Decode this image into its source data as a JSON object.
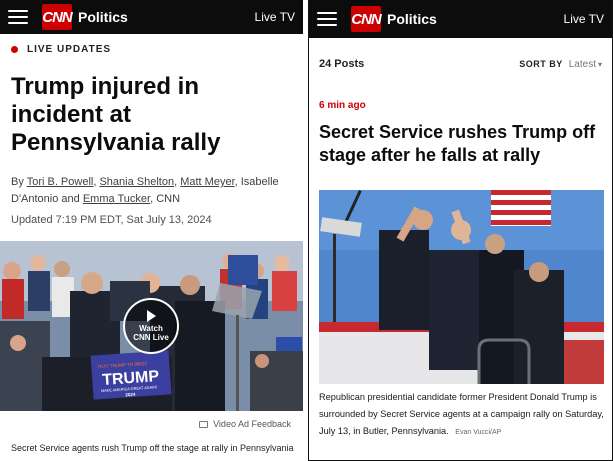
{
  "left": {
    "header": {
      "logo": "CNN",
      "section": "Politics",
      "live_tv": "Live TV"
    },
    "live_label": "LIVE UPDATES",
    "headline": "Trump injured in incident at Pennsylvania rally",
    "byline_prefix": "By",
    "authors": [
      "Tori B. Powell",
      "Shania Shelton",
      "Matt Meyer",
      "Isabelle D'Antonio",
      "Emma Tucker"
    ],
    "byline_suffix": "CNN",
    "updated": "Updated 7:19 PM EDT, Sat July 13, 2024",
    "video": {
      "watch_line1": "Watch",
      "watch_line2": "CNN Live",
      "sign_small": "TEXT TRUMP TO 88022",
      "sign_big": "TRUMP",
      "sign_sub": "MAKE AMERICA GREAT AGAIN!",
      "sign_year": "2024"
    },
    "video_feedback": "Video Ad Feedback",
    "caption": "Secret Service agents rush Trump off the stage at rally in Pennsylvania"
  },
  "right": {
    "header": {
      "logo": "CNN",
      "section": "Politics",
      "live_tv": "Live TV"
    },
    "posts_count": "24 Posts",
    "sort_by": "SORT BY",
    "sort_value": "Latest",
    "post_time": "6 min ago",
    "headline": "Secret Service rushes Trump off stage after he falls at rally",
    "caption": "Republican presidential candidate former President Donald Trump is surrounded by Secret Service agents at a campaign rally on Saturday, July 13, in Butler, Pennsylvania.",
    "credit": "Evan Vucci/AP"
  },
  "colors": {
    "brand_red": "#cc0000",
    "header_bg": "#0c0c0c",
    "sky_blue": "#4f86cc"
  },
  "icons": [
    "hamburger-icon",
    "play-icon",
    "feedback-icon",
    "chevron-down-icon"
  ]
}
